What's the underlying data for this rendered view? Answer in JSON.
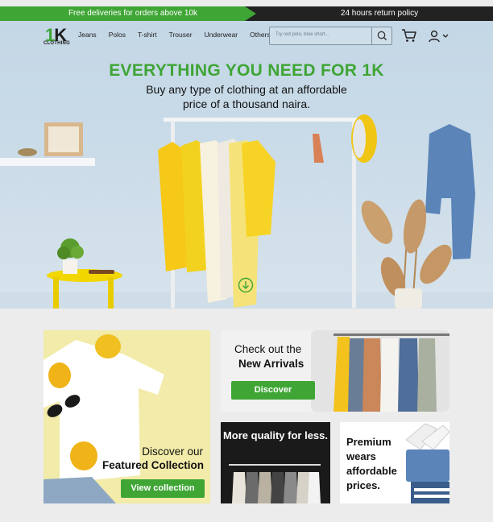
{
  "announcement": {
    "left_text": "Free deliveries for orders above 10k",
    "right_text": "24 hours return policy",
    "colors": {
      "green": "#3fa535",
      "dark": "#222222"
    }
  },
  "brand": {
    "logo_letter": "1",
    "logo_letter2": "K",
    "logo_text": "CLOTHING"
  },
  "nav": {
    "items": [
      "Jeans",
      "Polos",
      "T-shirt",
      "Trouser",
      "Underwear",
      "Others"
    ]
  },
  "search": {
    "placeholder": "Try red polo, blue short...",
    "icon": "search-icon"
  },
  "icons": {
    "cart": "cart-icon",
    "user": "user-icon",
    "menu": "chevron-down-icon"
  },
  "hero": {
    "title": "EVERYTHING YOU NEED FOR 1K",
    "subtitle": "Buy any type of clothing at an affordable price of a thousand naira."
  },
  "promos": {
    "featured": {
      "line1": "Discover our",
      "line2": "Featured Collection",
      "button": "View collection"
    },
    "arrivals": {
      "line1": "Check out the",
      "line2": "New Arrivals",
      "button": "Discover"
    },
    "quality": {
      "text": "More quality for less."
    },
    "premium": {
      "text": "Premium wears affordable prices."
    }
  }
}
